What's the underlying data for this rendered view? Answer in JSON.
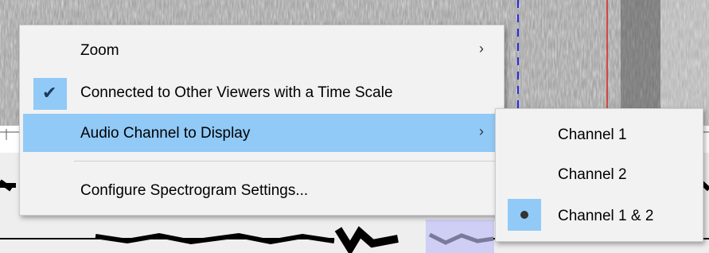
{
  "context_menu": {
    "items": [
      {
        "label": "Zoom",
        "submenu_arrow": "›"
      },
      {
        "label": "Connected to Other Viewers with a Time Scale",
        "checked": true,
        "check_glyph": "✔"
      },
      {
        "label": "Audio Channel to Display",
        "submenu_arrow": "›",
        "highlighted": true
      },
      {
        "label": "Configure Spectrogram Settings..."
      }
    ]
  },
  "channel_submenu": {
    "items": [
      {
        "label": "Channel 1"
      },
      {
        "label": "Channel 2"
      },
      {
        "label": "Channel 1 & 2",
        "selected": true
      }
    ]
  },
  "colors": {
    "highlight": "#91c9f7",
    "menu_background": "#f2f2f2",
    "playhead": "#e02020",
    "marker": "#2a2ae0",
    "waveform_selection": "#cfcff5"
  }
}
